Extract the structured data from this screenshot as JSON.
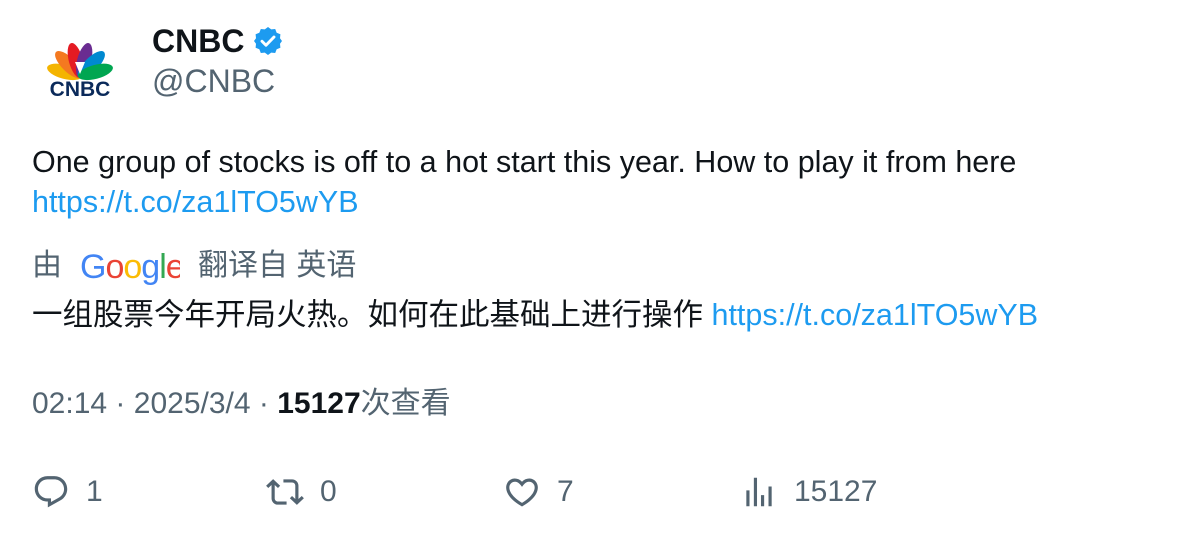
{
  "author": {
    "avatar_icon": "cnbc-peacock-logo",
    "avatar_text": "CNBC",
    "display_name": "CNBC",
    "verified_icon": "verified-badge-icon",
    "handle": "@CNBC"
  },
  "tweet": {
    "text": "One group of stocks is off to a hot start this year. How to play it from here",
    "link": "https://t.co/za1lTO5wYB"
  },
  "translation": {
    "by_label": "由",
    "provider": "Google",
    "from_label": "翻译自 英语",
    "text": "一组股票今年开局火热。如何在此基础上进行操作",
    "link": "https://t.co/za1lTO5wYB"
  },
  "meta": {
    "time": "02:14",
    "separator": "·",
    "date": "2025/3/4",
    "views_count": "15127",
    "views_label": "次查看"
  },
  "actions": {
    "reply": {
      "icon": "reply-icon",
      "count": "1"
    },
    "retweet": {
      "icon": "retweet-icon",
      "count": "0"
    },
    "like": {
      "icon": "heart-icon",
      "count": "7"
    },
    "views": {
      "icon": "analytics-icon",
      "count": "15127"
    }
  },
  "colors": {
    "link": "#1d9bf0",
    "secondary_text": "#536471",
    "primary_text": "#0f1419",
    "verified": "#1d9bf0"
  }
}
